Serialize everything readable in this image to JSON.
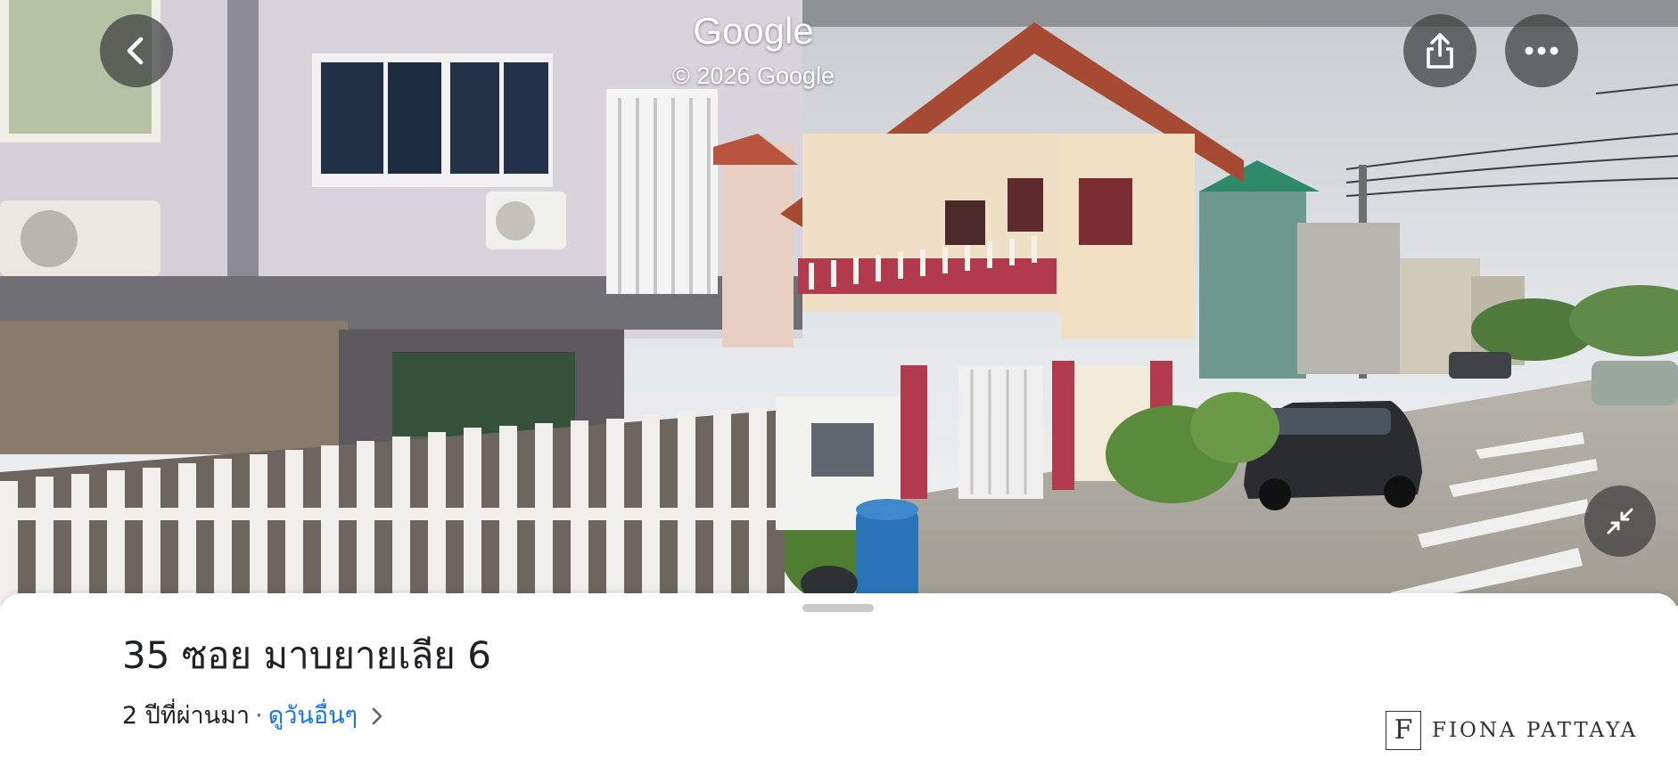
{
  "header": {
    "brand": "Google",
    "copyright": "© 2026 Google"
  },
  "icons": {
    "back": "chevron-left-icon",
    "share": "share-icon",
    "more": "more-horizontal-icon",
    "collapse": "collapse-arrows-icon",
    "details": "chevron-right-icon"
  },
  "place": {
    "address": "35 ซอย มาบยายเลีย 6",
    "age": "2 ปีที่ผ่านมา",
    "separator": "·",
    "other_days_link": "ดูวันอื่นๆ"
  },
  "watermark": {
    "letter": "F",
    "text": "FIONA PATTAYA"
  },
  "colors": {
    "link": "#1a73e8",
    "button_bg": "#3c3c3c",
    "sheet_bg": "#ffffff",
    "text": "#202124"
  }
}
